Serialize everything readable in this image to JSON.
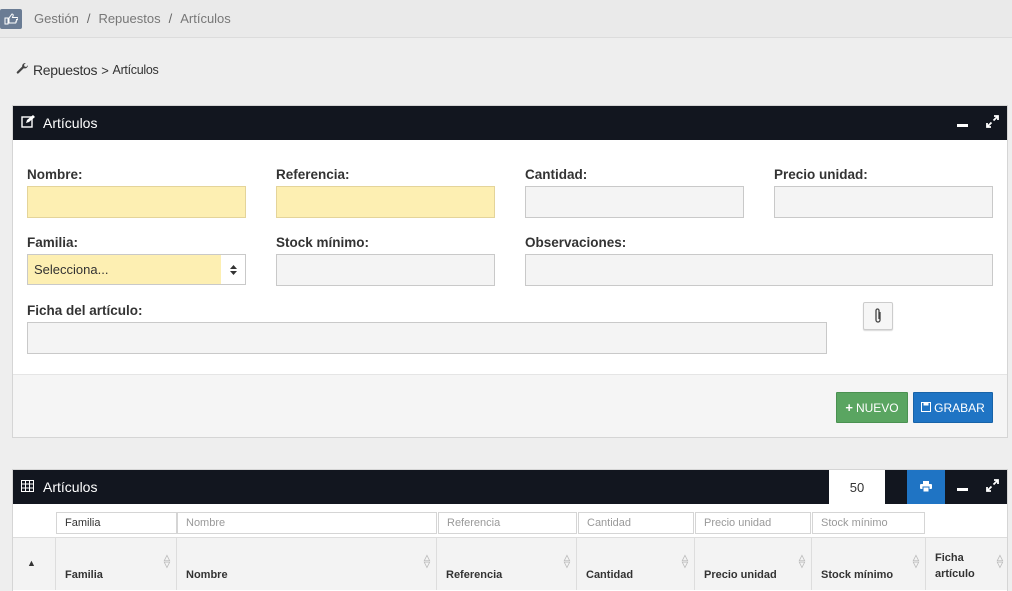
{
  "breadcrumb": {
    "home_icon": "hand-point-right-icon",
    "items": [
      "Gestión",
      "Repuestos",
      "Artículos"
    ],
    "separator": "/"
  },
  "page_title": {
    "icon": "wrench-icon",
    "section": "Repuestos",
    "separator": ">",
    "current": "Artículos"
  },
  "form_panel": {
    "title": "Artículos",
    "icon": "edit-icon",
    "fields": {
      "nombre": {
        "label": "Nombre:",
        "value": ""
      },
      "referencia": {
        "label": "Referencia:",
        "value": ""
      },
      "cantidad": {
        "label": "Cantidad:",
        "value": ""
      },
      "precio": {
        "label": "Precio unidad:",
        "value": ""
      },
      "familia": {
        "label": "Familia:",
        "selected": "Selecciona..."
      },
      "stock": {
        "label": "Stock mínimo:",
        "value": ""
      },
      "observaciones": {
        "label": "Observaciones:",
        "value": ""
      },
      "ficha": {
        "label": "Ficha del artículo:",
        "value": ""
      }
    },
    "buttons": {
      "nuevo": "NUEVO",
      "grabar": "GRABAR"
    },
    "colors": {
      "required_bg": "#fdefb2",
      "green": "#5aa561",
      "blue": "#1f74c4"
    }
  },
  "table_panel": {
    "title": "Artículos",
    "icon": "table-icon",
    "page_size": "50",
    "filters": [
      "Familia",
      "Nombre",
      "Referencia",
      "Cantidad",
      "Precio unidad",
      "Stock mínimo"
    ],
    "columns": [
      "Familia",
      "Nombre",
      "Referencia",
      "Cantidad",
      "Precio unidad",
      "Stock mínimo",
      "Ficha artículo"
    ]
  }
}
